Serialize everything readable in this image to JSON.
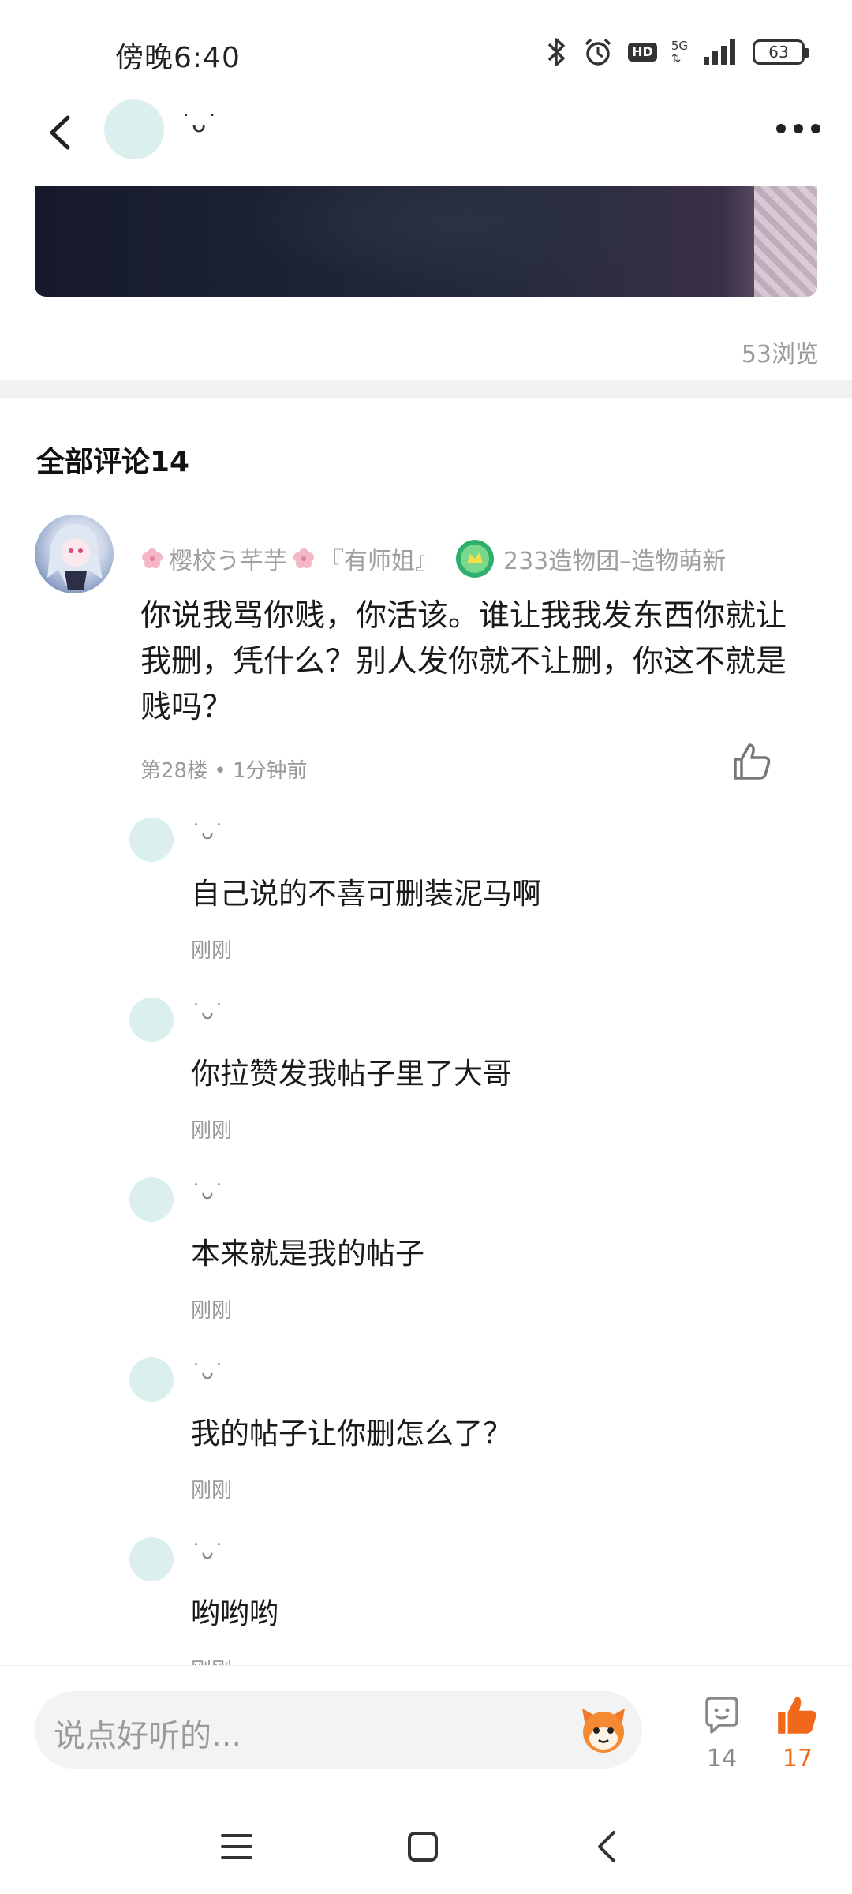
{
  "status_bar": {
    "time": "傍晚6:40",
    "network": "5G",
    "hd_badge": "HD",
    "battery": "63"
  },
  "header": {
    "username": "˙ᴗ˙"
  },
  "post": {
    "views": "53浏览"
  },
  "comments_section": {
    "title": "全部评论14"
  },
  "comment": {
    "author": "樱校う芊芋",
    "author_suffix": "『有师姐』",
    "badge_text": "233造物团–造物萌新",
    "text": "你说我骂你贱，你活该。谁让我我发东西你就让我删，凭什么？别人发你就不让删，你这不就是贱吗？",
    "meta": "第28楼 • 1分钟前"
  },
  "replies": [
    {
      "name": "˙ᴗ˙",
      "text": "自己说的不喜可删装泥马啊",
      "time": "刚刚"
    },
    {
      "name": "˙ᴗ˙",
      "text": "你拉赞发我帖子里了大哥",
      "time": "刚刚"
    },
    {
      "name": "˙ᴗ˙",
      "text": "本来就是我的帖子",
      "time": "刚刚"
    },
    {
      "name": "˙ᴗ˙",
      "text": "我的帖子让你删怎么了？",
      "time": "刚刚"
    },
    {
      "name": "˙ᴗ˙",
      "text": "哟哟哟",
      "time": "刚刚"
    }
  ],
  "bottom_bar": {
    "input_placeholder": "说点好听的...",
    "comment_count": "14",
    "like_count": "17",
    "accent_color": "#f0681a"
  }
}
